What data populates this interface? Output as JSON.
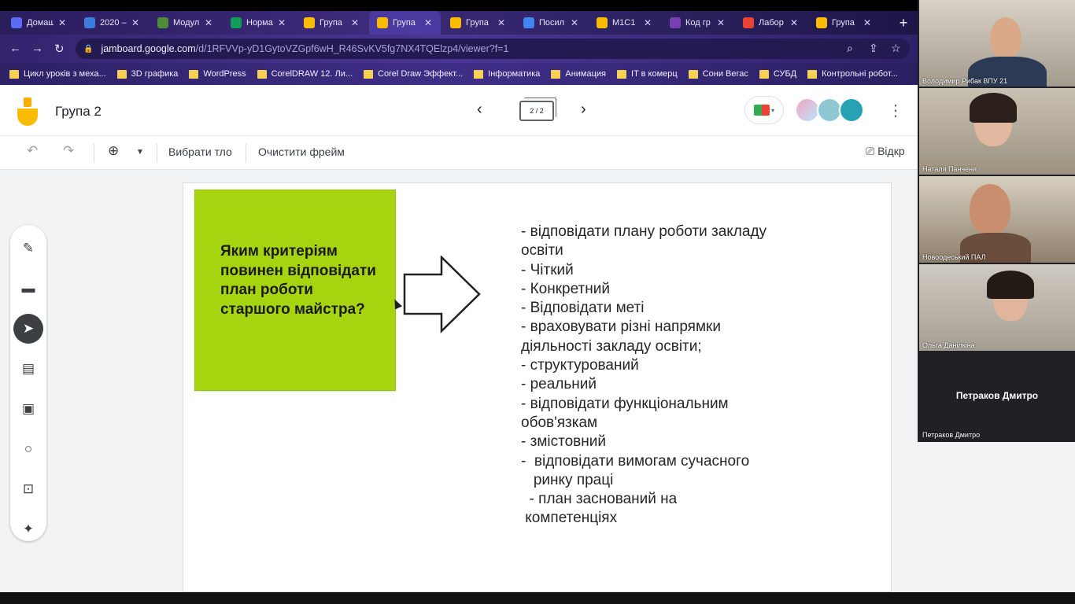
{
  "browser": {
    "tabs": [
      {
        "label": "Домаш",
        "color": "#5b6cf2",
        "active": false
      },
      {
        "label": "2020 –",
        "color": "#3d7be0",
        "active": false
      },
      {
        "label": "Модул",
        "color": "#4e8b3a",
        "active": false
      },
      {
        "label": "Норма",
        "color": "#0f9d58",
        "active": false
      },
      {
        "label": "Група",
        "color": "#fbbc04",
        "active": false
      },
      {
        "label": "Група",
        "color": "#fbbc04",
        "active": true
      },
      {
        "label": "Група",
        "color": "#fbbc04",
        "active": false
      },
      {
        "label": "Посил",
        "color": "#4285f4",
        "active": false
      },
      {
        "label": "M1C1",
        "color": "#fbbc04",
        "active": false
      },
      {
        "label": "Код гр",
        "color": "#7b3fb5",
        "active": false
      },
      {
        "label": "Лабор",
        "color": "#ea4335",
        "active": false
      },
      {
        "label": "Група",
        "color": "#fbbc04",
        "active": false
      }
    ],
    "url_host": "jamboard.google.com",
    "url_path": "/d/1RFVVp-yD1GytoVZGpf6wH_R46SvKV5fg7NX4TQElzp4/viewer?f=1",
    "bookmarks": [
      "Цикл уроків з меха...",
      "3D графика",
      "WordPress",
      "CorelDRAW 12. Ли...",
      "Corel Draw Эффект...",
      "Інформатика",
      "Анимация",
      "IT в комерц",
      "Сони Вегас",
      "СУБД",
      "Контрольні робот..."
    ]
  },
  "jamboard": {
    "title": "Група 2",
    "frame_indicator": "2 / 2",
    "toolbar": {
      "set_background": "Вибрати тло",
      "clear_frame": "Очистити фрейм",
      "present": "Відкр"
    },
    "sticky_note": {
      "text": "Яким критеріям повинен відповідати план роботи старшого майстра?",
      "color": "#a6d50f"
    },
    "notes": [
      "- відповідати плану роботи закладу",
      "освіти",
      "- Чіткий",
      "- Конкретний",
      "- Відповідати меті",
      "- враховувати різні напрямки",
      "діяльності закладу освіти;",
      "- структурований",
      "- реальний",
      "- відповідати функціональним",
      "обов'язкам",
      "- змістовний",
      "-  відповідати вимогам сучасного",
      "   ринку праці",
      "  - план заснований на",
      " компетенціях"
    ]
  },
  "meet": {
    "participants": [
      {
        "name": "Володимир Рибак ВПУ 21"
      },
      {
        "name": "Наталя Панченя"
      },
      {
        "name": "Новоодеський ПАЛ"
      },
      {
        "name": "Ольга Данілкіна"
      },
      {
        "name": "Петраков Дмитро",
        "display_name": "Петраков Дмитро"
      }
    ]
  }
}
